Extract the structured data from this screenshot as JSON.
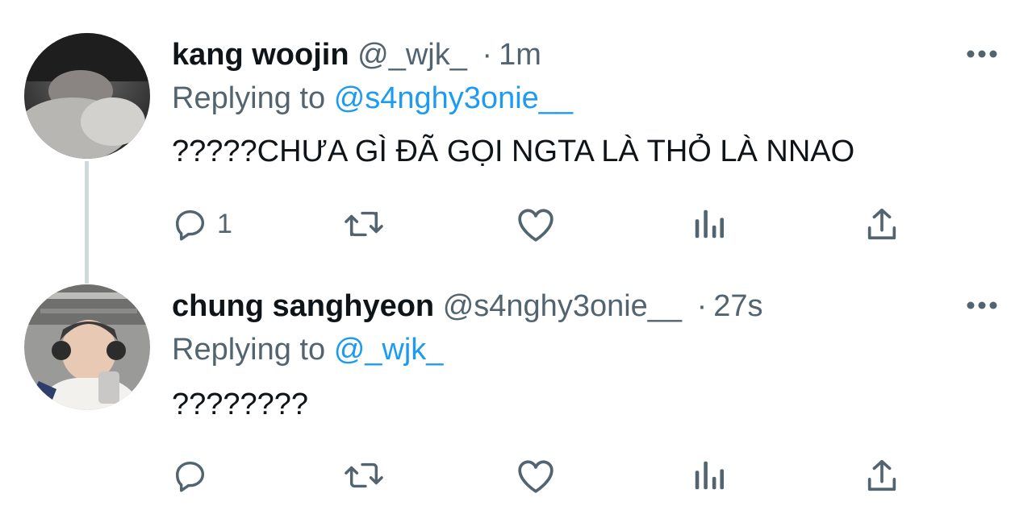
{
  "tweets": [
    {
      "display_name": "kang woojin",
      "handle": "@_wjk_",
      "separator": "·",
      "time": "1m",
      "reply_prefix": "Replying to",
      "reply_to": "@s4nghy3onie__",
      "text": "?????CHƯA GÌ ĐÃ GỌI NGTA LÀ THỎ LÀ NNAO",
      "reply_count": "1"
    },
    {
      "display_name": "chung sanghyeon",
      "handle": "@s4nghy3onie__",
      "separator": "·",
      "time": "27s",
      "reply_prefix": "Replying to",
      "reply_to": "@_wjk_",
      "text": "????????",
      "reply_count": ""
    }
  ],
  "icons": {
    "more": "more-horizontal-icon",
    "reply": "reply-bubble-icon",
    "retweet": "retweet-icon",
    "like": "heart-icon",
    "views": "views-chart-icon",
    "share": "share-upload-icon"
  },
  "colors": {
    "text": "#0f1419",
    "secondary": "#536471",
    "link": "#1d9bf0",
    "thread_line": "#cfd9de"
  }
}
